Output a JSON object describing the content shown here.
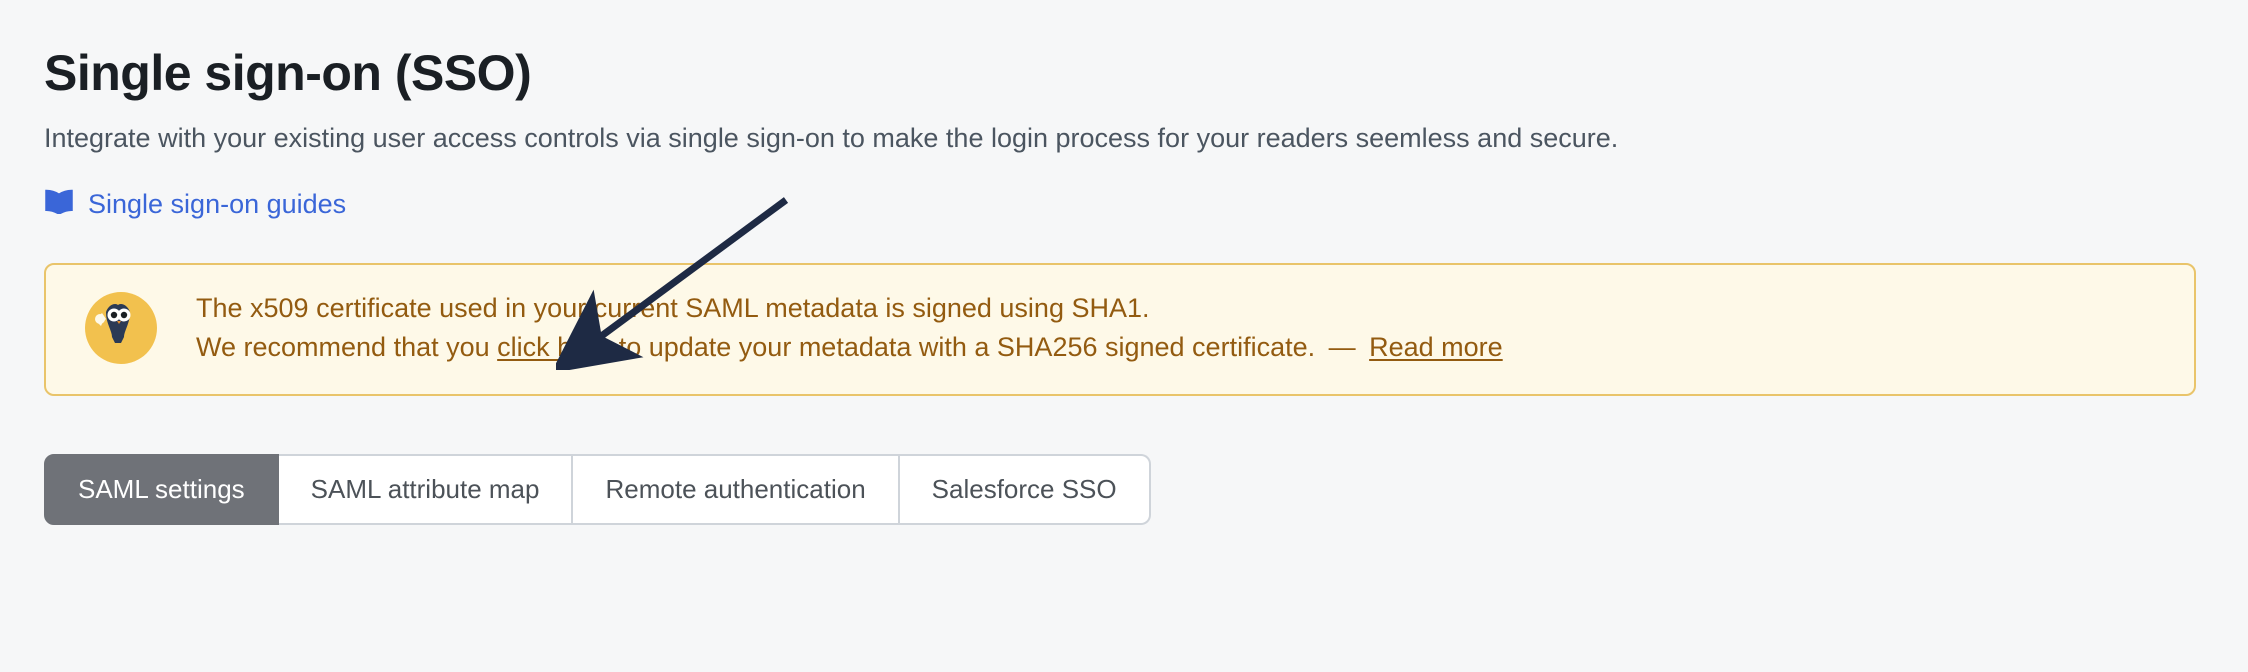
{
  "header": {
    "title": "Single sign-on (SSO)",
    "description": "Integrate with your existing user access controls via single sign-on to make the login process for your readers seemless and secure.",
    "guides_link": "Single sign-on guides"
  },
  "banner": {
    "line1": "The x509 certificate used in your current SAML metadata is signed using SHA1.",
    "line2_pre": "We recommend that you ",
    "line2_link": "click here",
    "line2_post": " to update your metadata with a SHA256 signed certificate. ",
    "sep": "—",
    "read_more": "Read more",
    "icon_name": "owl-bell-icon"
  },
  "tabs": [
    {
      "label": "SAML settings",
      "active": true
    },
    {
      "label": "SAML attribute map",
      "active": false
    },
    {
      "label": "Remote authentication",
      "active": false
    },
    {
      "label": "Salesforce SSO",
      "active": false
    }
  ],
  "annotation": {
    "arrow_target": "click-here-link"
  }
}
